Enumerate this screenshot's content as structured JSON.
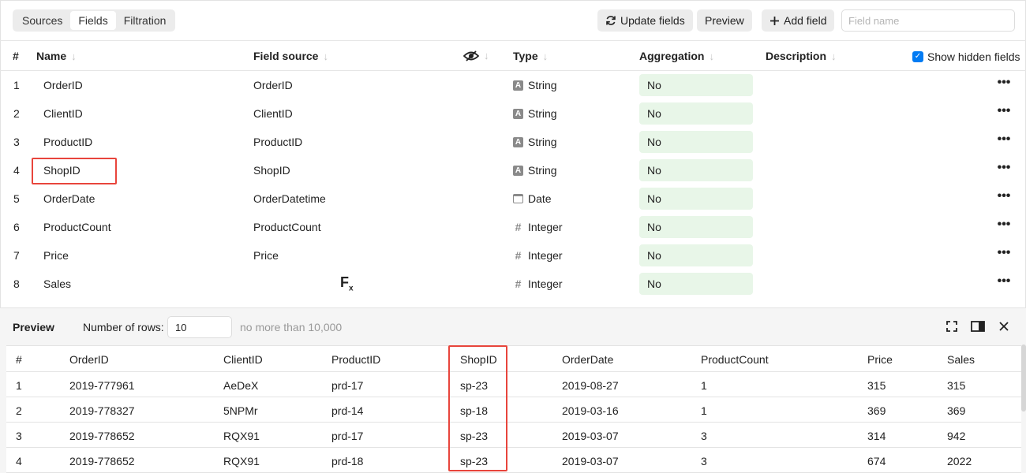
{
  "tabs": [
    {
      "label": "Sources"
    },
    {
      "label": "Fields"
    },
    {
      "label": "Filtration"
    }
  ],
  "active_tab": "Fields",
  "toolbar": {
    "update_label": "Update fields",
    "preview_label": "Preview",
    "add_label": "Add field",
    "field_name_placeholder": "Field name"
  },
  "fields_header": {
    "num": "#",
    "name": "Name",
    "source": "Field source",
    "type": "Type",
    "aggregation": "Aggregation",
    "description": "Description",
    "show_hidden": "Show hidden fields"
  },
  "fields": [
    {
      "num": "1",
      "name": "OrderID",
      "source": "OrderID",
      "type": "String",
      "type_icon": "string-type-icon",
      "aggregation": "No"
    },
    {
      "num": "2",
      "name": "ClientID",
      "source": "ClientID",
      "type": "String",
      "type_icon": "string-type-icon",
      "aggregation": "No"
    },
    {
      "num": "3",
      "name": "ProductID",
      "source": "ProductID",
      "type": "String",
      "type_icon": "string-type-icon",
      "aggregation": "No"
    },
    {
      "num": "4",
      "name": "ShopID",
      "source": "ShopID",
      "type": "String",
      "type_icon": "string-type-icon",
      "aggregation": "No"
    },
    {
      "num": "5",
      "name": "OrderDate",
      "source": "OrderDatetime",
      "type": "Date",
      "type_icon": "date-type-icon",
      "aggregation": "No"
    },
    {
      "num": "6",
      "name": "ProductCount",
      "source": "ProductCount",
      "type": "Integer",
      "type_icon": "integer-type-icon",
      "aggregation": "No"
    },
    {
      "num": "7",
      "name": "Price",
      "source": "Price",
      "type": "Integer",
      "type_icon": "integer-type-icon",
      "aggregation": "No"
    },
    {
      "num": "8",
      "name": "Sales",
      "source": "",
      "type": "Integer",
      "type_icon": "integer-type-icon",
      "aggregation": "No",
      "formula": "F"
    }
  ],
  "preview": {
    "title": "Preview",
    "rows_label": "Number of rows:",
    "rows_value": "10",
    "hint": "no more than 10,000",
    "columns": [
      "#",
      "OrderID",
      "ClientID",
      "ProductID",
      "ShopID",
      "OrderDate",
      "ProductCount",
      "Price",
      "Sales"
    ],
    "rows": [
      [
        "1",
        "2019-777961",
        "AeDeX",
        "prd-17",
        "sp-23",
        "2019-08-27",
        "1",
        "315",
        "315"
      ],
      [
        "2",
        "2019-778327",
        "5NPMr",
        "prd-14",
        "sp-18",
        "2019-03-16",
        "1",
        "369",
        "369"
      ],
      [
        "3",
        "2019-778652",
        "RQX91",
        "prd-17",
        "sp-23",
        "2019-03-07",
        "3",
        "314",
        "942"
      ],
      [
        "4",
        "2019-778652",
        "RQX91",
        "prd-18",
        "sp-23",
        "2019-03-07",
        "3",
        "674",
        "2022"
      ]
    ]
  },
  "colors": {
    "aggregation_bg": "#e8f6e8",
    "checkbox": "#027bf3",
    "highlight": "#e8453c"
  }
}
